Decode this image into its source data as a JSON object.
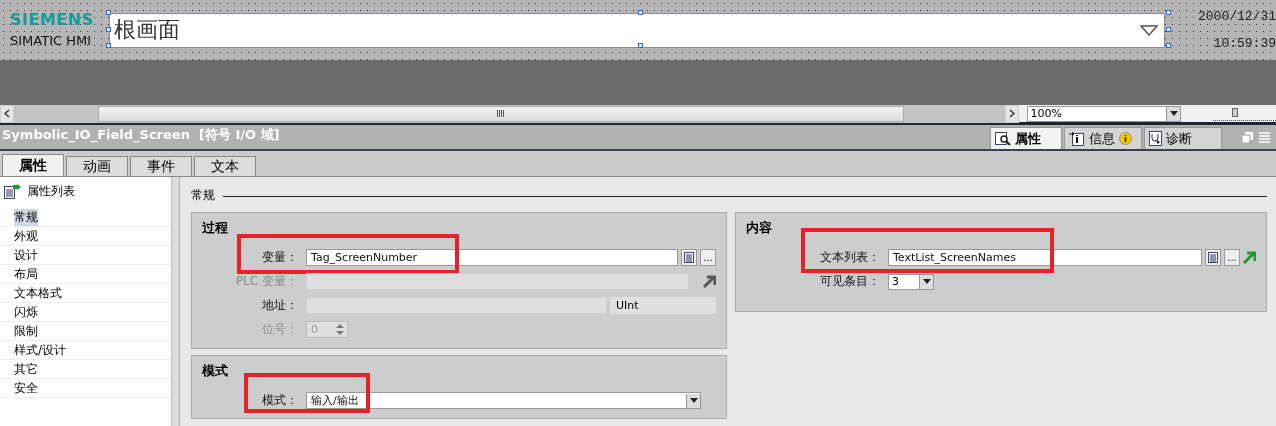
{
  "canvas": {
    "logo": "SIEMENS",
    "product": "SIMATIC HMI",
    "screen_field": "根画面",
    "date": "2000/12/31",
    "time": "10:59:39"
  },
  "zoom": {
    "value": "100%",
    "level": 0.35
  },
  "inspector": {
    "title": "Symbolic_IO_Field_Screen  [符号 I/O 域]",
    "panel_tabs": [
      {
        "kind": "properties",
        "label": "属性",
        "selected": true
      },
      {
        "kind": "info",
        "label": "信息",
        "selected": false
      },
      {
        "kind": "diagnostics",
        "label": "诊断",
        "selected": false
      }
    ],
    "tabs": [
      {
        "label": "属性",
        "selected": true
      },
      {
        "label": "动画",
        "selected": false
      },
      {
        "label": "事件",
        "selected": false
      },
      {
        "label": "文本",
        "selected": false
      }
    ],
    "nav_title": "属性列表",
    "nav_items": [
      {
        "label": "常规",
        "selected": true
      },
      {
        "label": "外观",
        "selected": false
      },
      {
        "label": "设计",
        "selected": false
      },
      {
        "label": "布局",
        "selected": false
      },
      {
        "label": "文本格式",
        "selected": false
      },
      {
        "label": "闪烁",
        "selected": false
      },
      {
        "label": "限制",
        "selected": false
      },
      {
        "label": "样式/设计",
        "selected": false
      },
      {
        "label": "其它",
        "selected": false
      },
      {
        "label": "安全",
        "selected": false
      }
    ],
    "section": "常规",
    "columns": [
      [
        {
          "title": "过程",
          "rows": [
            {
              "kind": "tag",
              "label": "变量：",
              "value": "Tag_ScreenNumber",
              "browse": "...",
              "highlighted": true,
              "disabled": false
            },
            {
              "kind": "link",
              "label": "PLC 变量：",
              "highlighted": false,
              "disabled": true
            },
            {
              "kind": "address",
              "label": "地址：",
              "unit": "UInt",
              "highlighted": false,
              "disabled": false
            },
            {
              "kind": "spin",
              "label": "位号：",
              "value": "0",
              "highlighted": false,
              "disabled": true
            }
          ]
        },
        {
          "title": "模式",
          "rows": [
            {
              "kind": "dropdown",
              "label": "模式：",
              "value": "输入/输出",
              "highlighted": true,
              "disabled": false
            }
          ]
        }
      ],
      [
        {
          "title": "内容",
          "rows": [
            {
              "kind": "tag-link",
              "label": "文本列表：",
              "value": "TextList_ScreenNames",
              "browse": "...",
              "highlighted": true,
              "disabled": false
            },
            {
              "kind": "small-dropdown",
              "label": "可见条目：",
              "value": "3",
              "highlighted": false,
              "disabled": false
            }
          ]
        }
      ]
    ]
  }
}
